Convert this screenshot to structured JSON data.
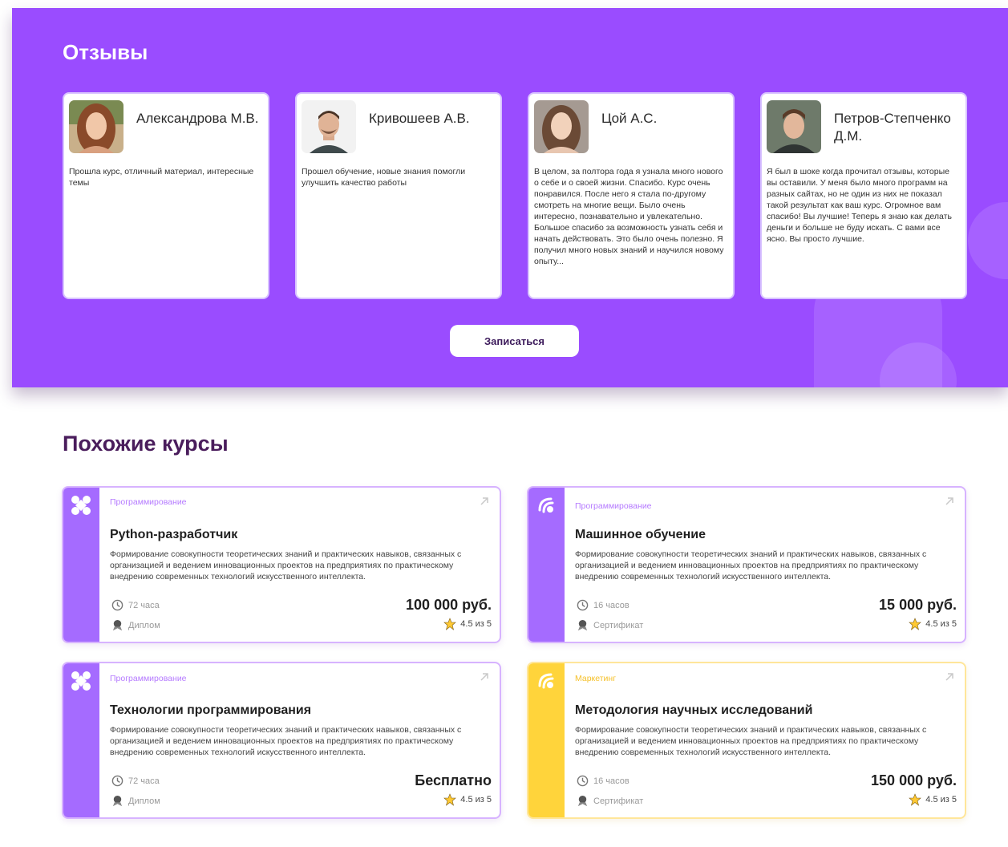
{
  "reviews": {
    "title": "Отзывы",
    "enroll_label": "Записаться",
    "items": [
      {
        "name": "Александрова М.В.",
        "text": "Прошла курс, отличный материал, интересные темы"
      },
      {
        "name": "Кривошеев А.В.",
        "text": "Прошел обучение, новые знания помогли улучшить качество работы"
      },
      {
        "name": "Цой А.С.",
        "text": "В целом, за полтора года я узнала много нового о себе и о своей жизни. Спасибо. Курс очень понравился. После него я стала по-другому смотреть на многие вещи. Было очень интересно, познавательно и увлекательно. Большое спасибо за возможность узнать себя и начать действовать. Это было очень полезно. Я получил много новых знаний и научился новому опыту..."
      },
      {
        "name": "Петров-Степченко Д.М.",
        "text": "Я был в шоке когда прочитал отзывы, которые вы оставили. У меня было много программ на разных сайтах, но не один из них не показал такой результат как ваш курс. Огромное вам спасибо! Вы лучшие! Теперь я знаю как делать деньги и больше не буду искать. С вами все ясно. Вы просто лучшие."
      }
    ]
  },
  "similar": {
    "title": "Похожие курсы",
    "courses": [
      {
        "category": "Программирование",
        "name": "Python-разработчик",
        "description": "Формирование совокупности теоретических знаний и практических навыков, связанных с организацией и ведением инновационных проектов на предприятиях по практическому внедрению современных технологий искусственного интеллекта.",
        "hours": "72 часа",
        "document": "Диплом",
        "price": "100 000 руб.",
        "rating": "4.5 из 5",
        "icon": "cross-petals-icon",
        "accent": "#a56bff"
      },
      {
        "category": "Программирование",
        "name": "Машинное обучение",
        "description": "Формирование совокупности теоретических знаний и практических навыков, связанных с организацией и ведением инновационных проектов на предприятиях по практическому внедрению современных технологий искусственного интеллекта.",
        "hours": "16 часов",
        "document": "Сертификат",
        "price": "15 000 руб.",
        "rating": "4.5 из 5",
        "icon": "signal-swirl-icon",
        "accent": "#a56bff"
      },
      {
        "category": "Программирование",
        "name": "Технологии программирования",
        "description": "Формирование совокупности теоретических знаний и практических навыков, связанных с организацией и ведением инновационных проектов на предприятиях по практическому внедрению современных технологий искусственного интеллекта.",
        "hours": "72 часа",
        "document": "Диплом",
        "price": "Бесплатно",
        "rating": "4.5 из 5",
        "icon": "cross-petals-icon",
        "accent": "#a56bff"
      },
      {
        "category": "Маркетинг",
        "name": "Методология научных исследований",
        "description": "Формирование совокупности теоретических знаний и практических навыков, связанных с организацией и ведением инновационных проектов на предприятиях по практическому внедрению современных технологий искусственного интеллекта.",
        "hours": "16 часов",
        "document": "Сертификат",
        "price": "150 000 руб.",
        "rating": "4.5 из 5",
        "icon": "signal-swirl-icon",
        "accent": "#ffd43b"
      }
    ]
  },
  "colors": {
    "reviews_background": "#9a4cff",
    "purple_accent": "#a56bff",
    "yellow_accent": "#ffd43b",
    "heading_dark": "#4a1d5c"
  }
}
